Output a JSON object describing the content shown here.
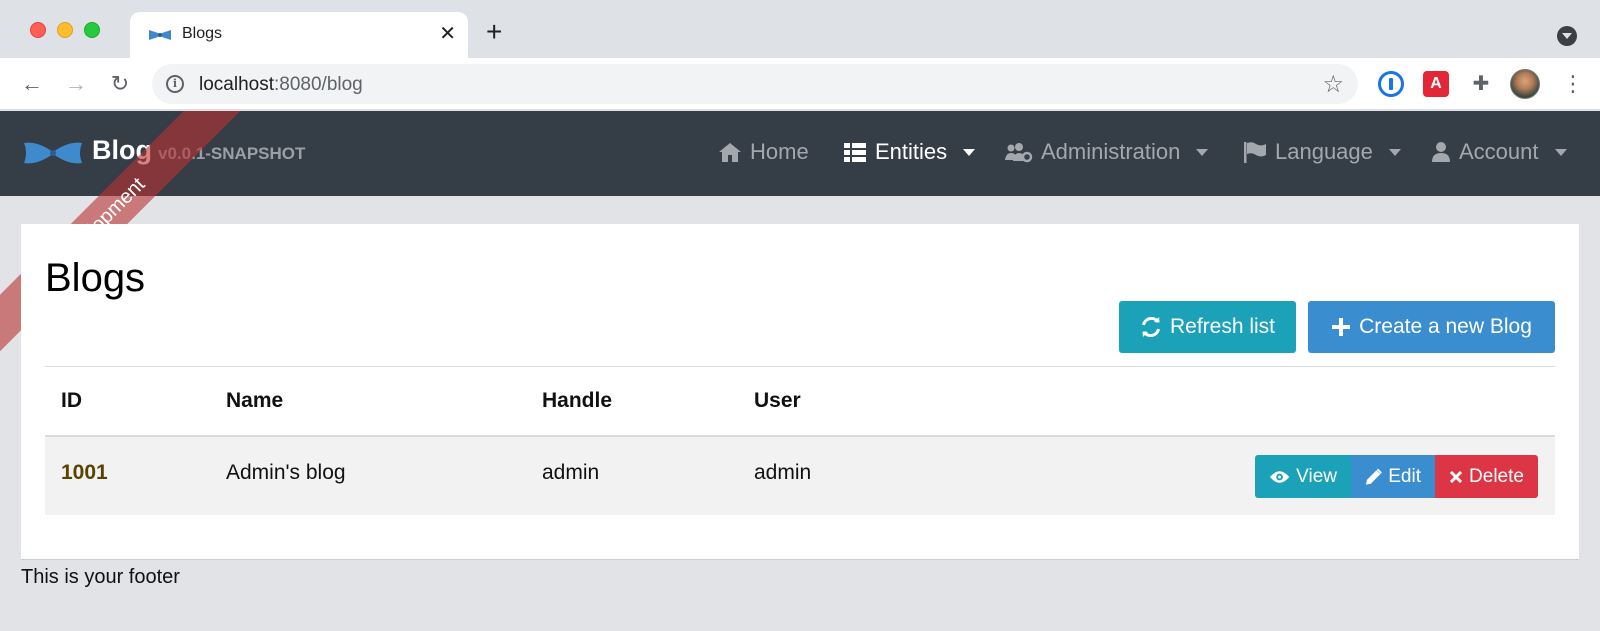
{
  "browser": {
    "tab_title": "Blogs",
    "tab_close_glyph": "✕",
    "new_tab_glyph": "+",
    "url_host": "localhost",
    "url_rest": ":8080/blog",
    "info_glyph": "i",
    "star_glyph": "☆",
    "back_glyph": "←",
    "forward_glyph": "→",
    "reload_glyph": "↻",
    "puzzle_glyph": "✚",
    "red_ext_glyph": "A",
    "kebab_glyph": "⋮"
  },
  "navbar": {
    "brand_title": "Blog",
    "brand_version": "v0.0.1-SNAPSHOT",
    "ribbon": "Development",
    "items": [
      {
        "label": "Home",
        "icon": "home-icon",
        "active": false,
        "dropdown": false
      },
      {
        "label": "Entities",
        "icon": "th-list-icon",
        "active": true,
        "dropdown": true
      },
      {
        "label": "Administration",
        "icon": "users-cog-icon",
        "active": false,
        "dropdown": true
      },
      {
        "label": "Language",
        "icon": "flag-icon",
        "active": false,
        "dropdown": true
      },
      {
        "label": "Account",
        "icon": "user-icon",
        "active": false,
        "dropdown": true
      }
    ]
  },
  "page": {
    "title": "Blogs",
    "refresh_label": "Refresh list",
    "create_label": "Create a new Blog",
    "refresh_icon": "sync-icon",
    "create_icon": "plus-icon"
  },
  "table": {
    "headers": [
      "ID",
      "Name",
      "Handle",
      "User"
    ],
    "rows": [
      {
        "id": "1001",
        "name": "Admin's blog",
        "handle": "admin",
        "user": "admin"
      }
    ],
    "actions": {
      "view": "View",
      "edit": "Edit",
      "delete": "Delete",
      "view_icon": "eye-icon",
      "edit_icon": "pencil-icon",
      "delete_icon": "times-icon"
    }
  },
  "footer": {
    "text": "This is your footer"
  },
  "colors": {
    "navbar": "#353d47",
    "info": "#1ba2b8",
    "primary": "#3a8ed0",
    "danger": "#dc3545"
  }
}
